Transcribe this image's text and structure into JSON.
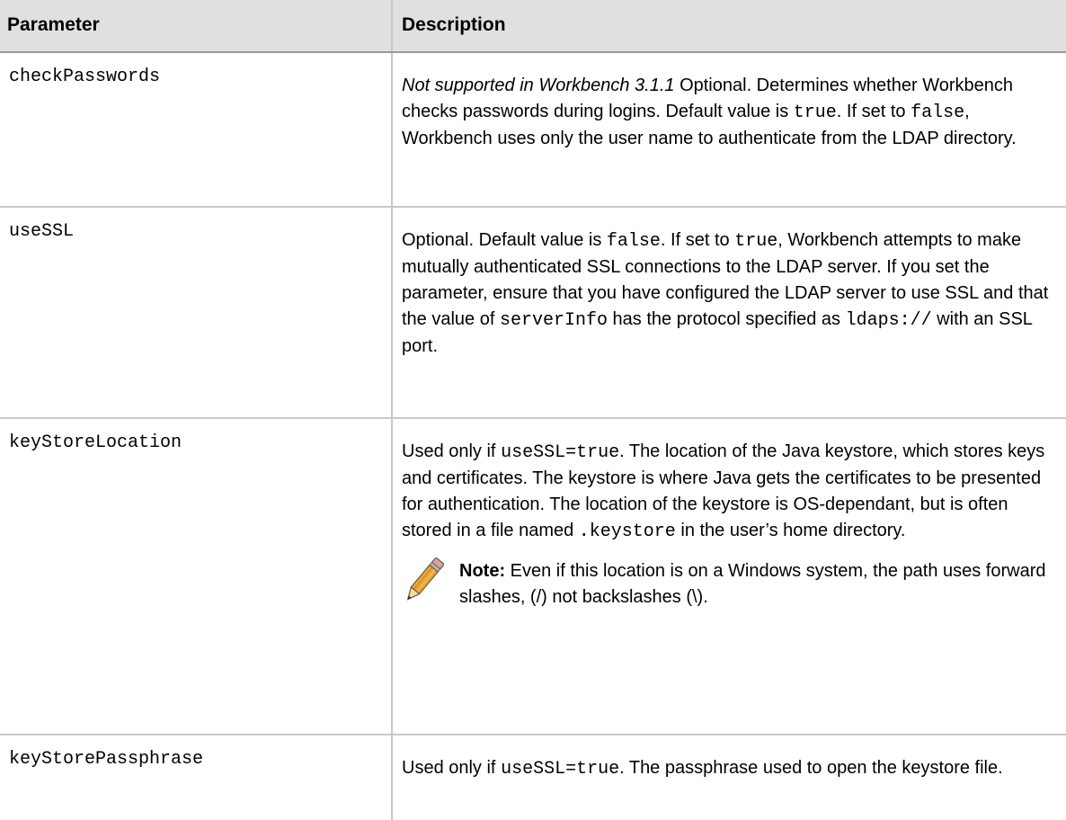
{
  "table": {
    "header": {
      "parameter": "Parameter",
      "description": "Description"
    },
    "rows": [
      {
        "name": "checkPasswords",
        "desc": {
          "not_supported": "Not supported in Workbench 3.1.1",
          "t1": " Optional. Determines whether Workbench checks passwords during logins. Default value is ",
          "code1": "true",
          "t2": ". If set to ",
          "code2": "false",
          "t3": ", Workbench uses only the user name to authenticate from the LDAP directory."
        }
      },
      {
        "name": "useSSL",
        "desc": {
          "t1": "Optional. Default value is ",
          "code1": "false",
          "t2": ". If set to ",
          "code2": "true",
          "t3": ", Workbench attempts to make mutually authenticated SSL connections to the LDAP server. If you set the parameter, ensure that you have configured the LDAP server to use SSL and that the value of ",
          "code3": "serverInfo",
          "t4": " has the protocol specified as ",
          "code4": "ldaps://",
          "t5": " with an SSL port."
        }
      },
      {
        "name": "keyStoreLocation",
        "desc": {
          "t1": "Used only if ",
          "code1": "useSSL=true",
          "t2": ". The location of the Java keystore, which stores keys and certificates. The keystore is where Java gets the certificates to be presented for authentication. The location of the keystore is OS-dependant, but is often stored in a file named ",
          "code2": ".keystore",
          "t3": " in the user’s home directory."
        },
        "note": {
          "icon": "pencil-icon",
          "label": "Note:",
          "text": "  Even if this location is on a Windows system, the path uses forward slashes, (/) not backslashes (\\)."
        }
      },
      {
        "name": "keyStorePassphrase",
        "desc": {
          "t1": "Used only if ",
          "code1": "useSSL=true",
          "t2": ". The passphrase used to open the keystore file."
        }
      }
    ]
  },
  "colors": {
    "header_bg": "#e0e0e0",
    "border": "#c8c8c8",
    "pencil_body": "#e8a63a",
    "pencil_tip": "#f3d9a8"
  }
}
